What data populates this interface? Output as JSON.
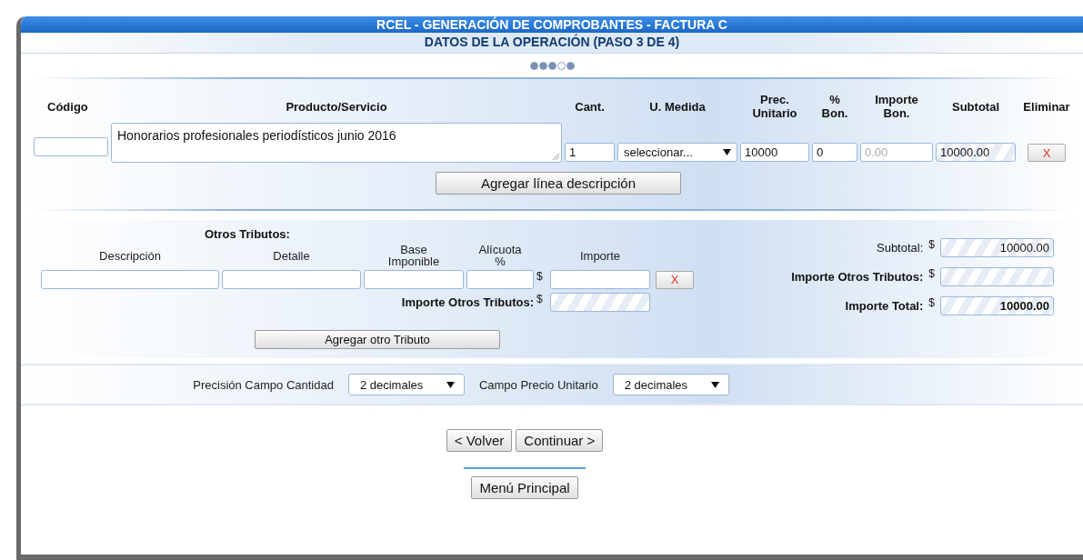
{
  "header": {
    "title": "RCEL - GENERACIÓN DE COMPROBANTES - FACTURA C",
    "subtitle": "DATOS DE LA OPERACIÓN (PASO 3 DE 4)",
    "steps": [
      {
        "filled": true
      },
      {
        "filled": true
      },
      {
        "filled": true
      },
      {
        "filled": false
      },
      {
        "filled": true
      }
    ]
  },
  "items": {
    "columns": [
      "Código",
      "Producto/Servicio",
      "Cant.",
      "U. Medida",
      "Prec. Unitario",
      "% Bon.",
      "Importe Bon.",
      "Subtotal",
      "Eliminar"
    ],
    "row": {
      "producto": "Honorarios profesionales periodísticos junio 2016",
      "cantidad": "1",
      "unidad": "seleccionar...",
      "precio": "10000",
      "bonificacion": "0",
      "importe_bon": {
        "placeholder": "0.00"
      },
      "subtotal": "10000.00",
      "delete": "X"
    },
    "add_button": "Agregar línea descripción"
  },
  "otros_tributos": {
    "title": "Otros Tributos:",
    "columns": [
      "Descripción",
      "Detalle",
      "Base Imponible",
      "Alícuota %",
      "Importe"
    ],
    "currency": "$",
    "delete": "X",
    "total_label": "Importe Otros Tributos:",
    "total_currency": "$",
    "add_button": "Agregar otro Tributo"
  },
  "totals": [
    {
      "label": "Subtotal:",
      "currency": "$",
      "value": "10000.00",
      "bold": false
    },
    {
      "label": "Importe Otros Tributos:",
      "currency": "$",
      "bold": true
    },
    {
      "label": "Importe Total:",
      "currency": "$",
      "value": "10000.00",
      "bold": true
    }
  ],
  "precision": [
    {
      "label": "Precisión Campo Cantidad",
      "value": "2 decimales"
    },
    {
      "label": "Campo Precio Unitario",
      "value": "2 decimales"
    }
  ],
  "nav_buttons": [
    "< Volver",
    "Continuar >"
  ],
  "menu_button": "Menú Principal"
}
